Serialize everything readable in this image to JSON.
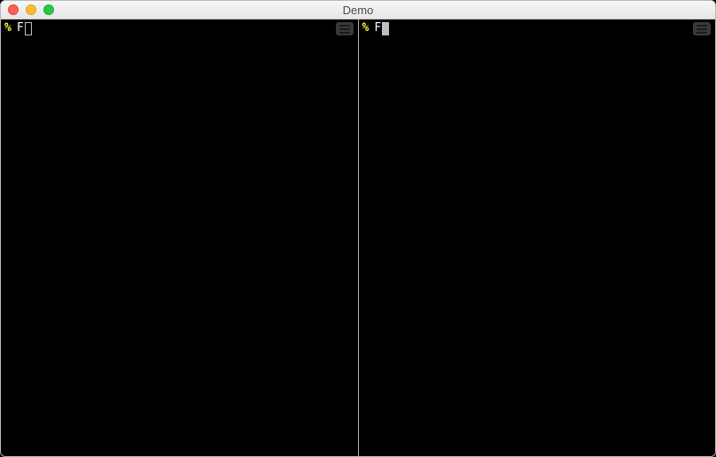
{
  "window": {
    "title": "Demo"
  },
  "panes": [
    {
      "prompt_symbol": "%",
      "input_text": "F",
      "active": false
    },
    {
      "prompt_symbol": "%",
      "input_text": "F",
      "active": true
    }
  ]
}
